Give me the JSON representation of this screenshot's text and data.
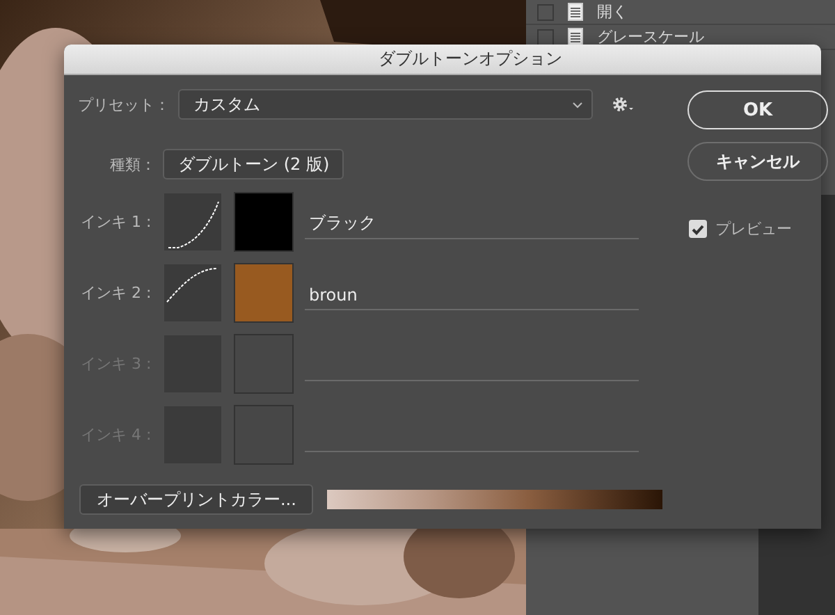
{
  "side_panel": {
    "items": [
      {
        "label": "開く",
        "checked": false
      },
      {
        "label": "グレースケール",
        "checked": false
      }
    ]
  },
  "dialog": {
    "title": "ダブルトーンオプション",
    "preset": {
      "label": "プリセット：",
      "value": "カスタム"
    },
    "type": {
      "label": "種類：",
      "value": "ダブルトーン (2 版)"
    },
    "inks": [
      {
        "label": "インキ 1 :",
        "kind": "ease-in",
        "color": "#000000",
        "name": "ブラック",
        "disabled": false
      },
      {
        "label": "インキ 2 :",
        "kind": "ease-out",
        "color": "#985a20",
        "name": "broun",
        "disabled": false
      },
      {
        "label": "インキ 3 :",
        "kind": "empty",
        "disabled": true
      },
      {
        "label": "インキ 4 :",
        "kind": "empty",
        "disabled": true
      }
    ],
    "overprint_button": "オーバープリントカラー...",
    "ok_button": "OK",
    "cancel_button": "キャンセル",
    "preview": {
      "label": "プレビュー",
      "checked": true
    }
  }
}
